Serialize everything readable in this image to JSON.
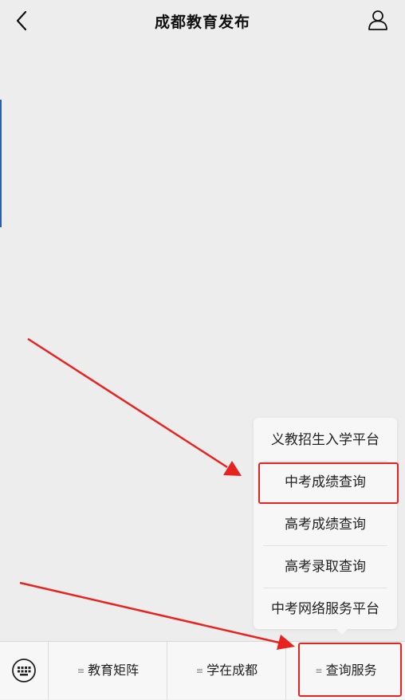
{
  "header": {
    "title": "成都教育发布",
    "back_icon": "chevron-left-icon",
    "profile_icon": "user-icon"
  },
  "popup_menu": {
    "items": [
      {
        "label": "义教招生入学平台"
      },
      {
        "label": "中考成绩查询",
        "highlighted": true
      },
      {
        "label": "高考成绩查询"
      },
      {
        "label": "高考录取查询"
      },
      {
        "label": "中考网络服务平台"
      }
    ]
  },
  "bottom_menu": {
    "keyboard_icon": "keyboard-icon",
    "tabs": [
      {
        "label": "教育矩阵"
      },
      {
        "label": "学在成都"
      },
      {
        "label": "查询服务",
        "highlighted": true
      }
    ]
  },
  "annotation": {
    "color": "#e8231f"
  }
}
